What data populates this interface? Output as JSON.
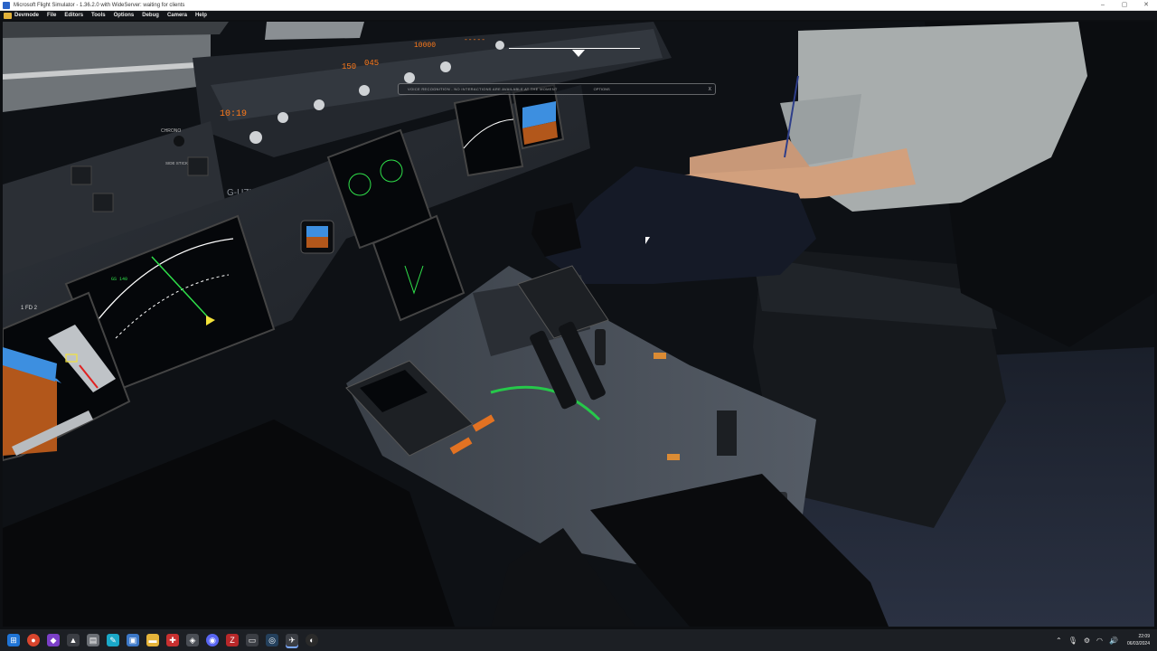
{
  "window": {
    "title": "Microsoft Flight Simulator - 1.36.2.0 with WideServer: waiting for clients",
    "controls": {
      "minimize": "–",
      "maximize": "▢",
      "close": "✕"
    }
  },
  "menu": {
    "items": [
      "Devmode",
      "File",
      "Editors",
      "Tools",
      "Options",
      "Debug",
      "Camera",
      "Help"
    ]
  },
  "overlay": {
    "message": "VOICE RECOGNITION - NO INTERACTIONS ARE AVAILABLE AT THE MOMENT",
    "options_label": "OPTIONS",
    "close_label": "X"
  },
  "cockpit": {
    "registration": "G-UZLF",
    "panel_labels": {
      "chrono": "CHRONO",
      "sidestick": "SIDE STICK PRIORITY",
      "fd": "1 FD 2"
    },
    "fcu_values": {
      "speed": "150",
      "heading": "045",
      "altitude": "10000",
      "vs": "-----"
    },
    "chrono_display": "10:19",
    "mcdu_display": "GS 140"
  },
  "taskbar": {
    "icons": [
      "windows-start",
      "chrome",
      "visual-studio",
      "app-a",
      "notepad",
      "feather",
      "app-b",
      "file-explorer",
      "app-c",
      "app-d",
      "discord",
      "filezilla",
      "app-e",
      "steam",
      "flight-sim",
      "obs"
    ],
    "time": "22:09",
    "date": "06/03/2024"
  },
  "colors": {
    "titlebar_bg": "#ffffff",
    "menubar_bg": "#121418",
    "taskbar_bg": "#1c1f24",
    "sky_blue": "#3d8fe0",
    "ground_brown": "#b2571b"
  }
}
